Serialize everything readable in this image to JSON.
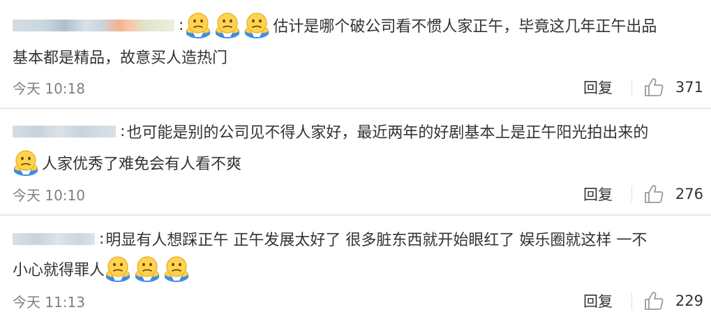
{
  "comments": [
    {
      "line1_text": "估计是哪个破公司看不惯人家正午，毕竟这几年正午出品",
      "line2_text": "基本都是精品，故意买人造热门",
      "time": "今天 10:18",
      "reply_label": "回复",
      "likes": "371"
    },
    {
      "line1_text": "也可能是别的公司见不得人家好，最近两年的好剧基本上是正午阳光拍出来的",
      "line2_text": "人家优秀了难免会有人看不爽",
      "time": "今天 10:10",
      "reply_label": "回复",
      "likes": "276"
    },
    {
      "line1_text": "明显有人想踩正午 正午发展太好了 很多脏东西就开始眼红了 娱乐圈就这样 一不",
      "line2_text": "小心就得罪人",
      "time": "今天 11:13",
      "reply_label": "回复",
      "likes": "229"
    }
  ],
  "colon": ":",
  "icons": {
    "emoji": "shrug-face-icon",
    "like": "thumbs-up-icon"
  },
  "colors": {
    "text": "#333333",
    "meta": "#808080",
    "emoji_face": "#ffd34d",
    "emoji_hands": "#3a8ee6"
  }
}
